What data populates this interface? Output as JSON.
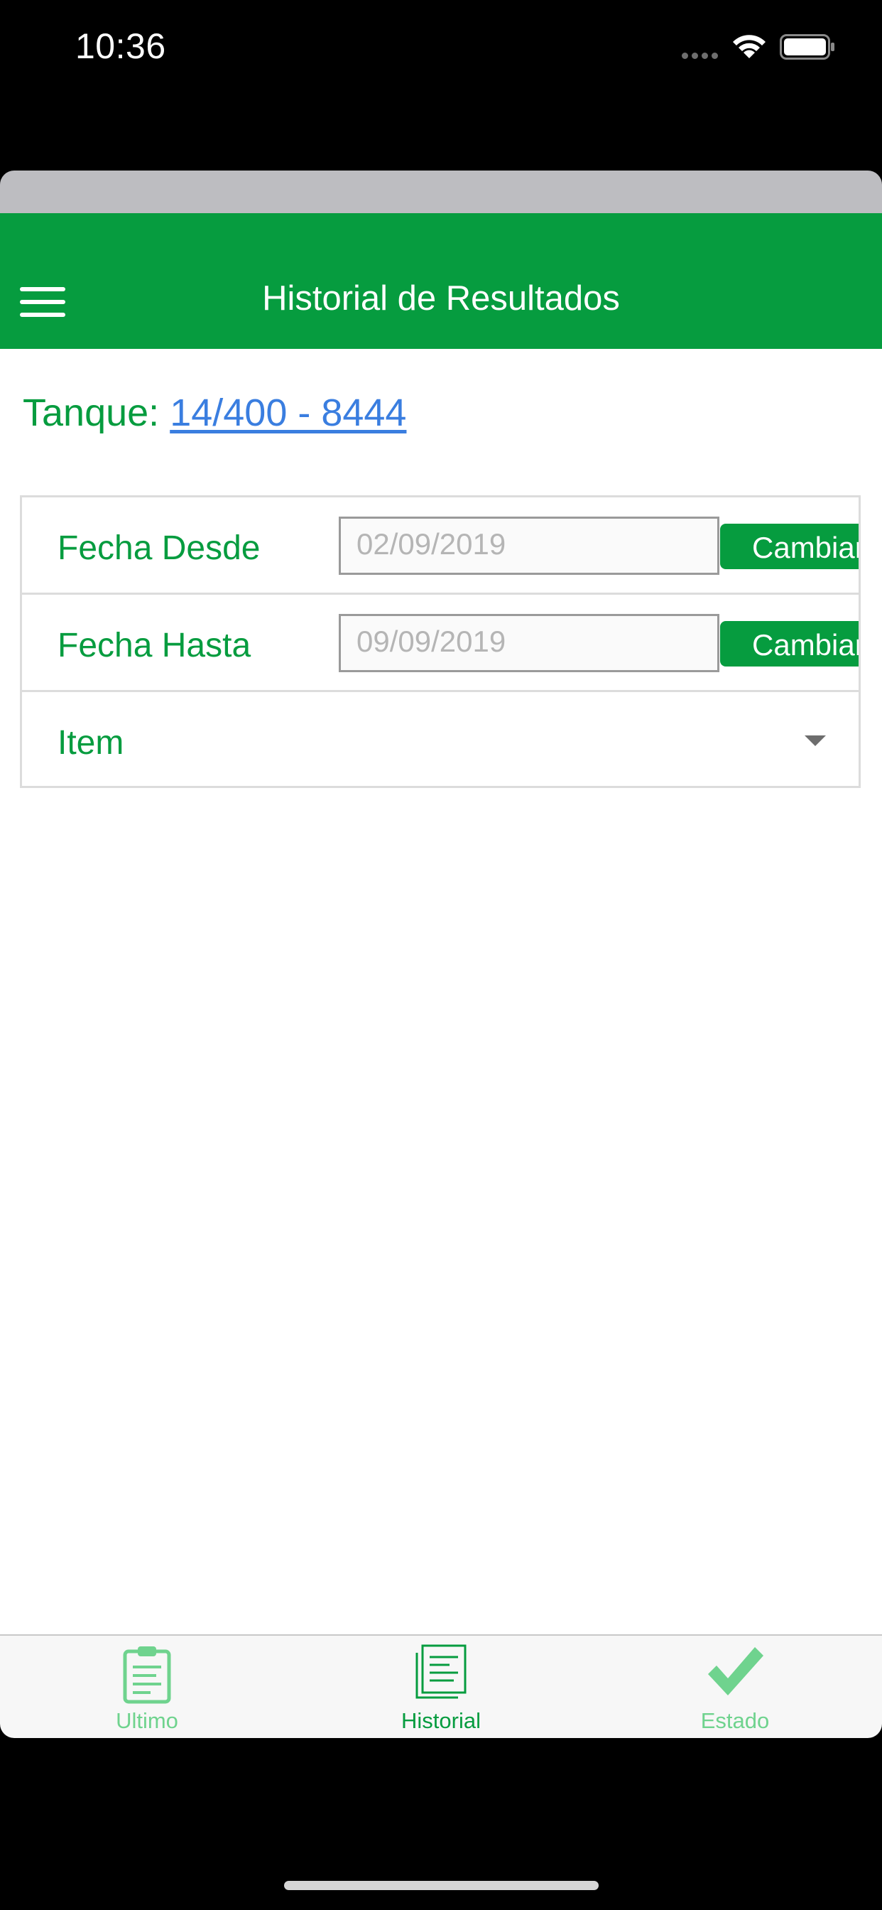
{
  "status_bar": {
    "time": "10:36"
  },
  "nav": {
    "title": "Historial de Resultados",
    "menu_icon": "hamburger-menu-icon"
  },
  "tank": {
    "label": "Tanque:",
    "value": "14/400 - 8444"
  },
  "form": {
    "from": {
      "label": "Fecha Desde",
      "value": "02/09/2019",
      "button": "Cambiar"
    },
    "to": {
      "label": "Fecha Hasta",
      "value": "09/09/2019",
      "button": "Cambiar"
    },
    "item": {
      "label": "Item"
    }
  },
  "tabs": [
    {
      "label": "Ultimo",
      "icon": "clipboard-icon",
      "active": false
    },
    {
      "label": "Historial",
      "icon": "document-list-icon",
      "active": true
    },
    {
      "label": "Estado",
      "icon": "checkmark-icon",
      "active": false
    }
  ],
  "colors": {
    "primary": "#069c3f",
    "link": "#3a7ee0",
    "tab_inactive": "#6fd38e"
  }
}
